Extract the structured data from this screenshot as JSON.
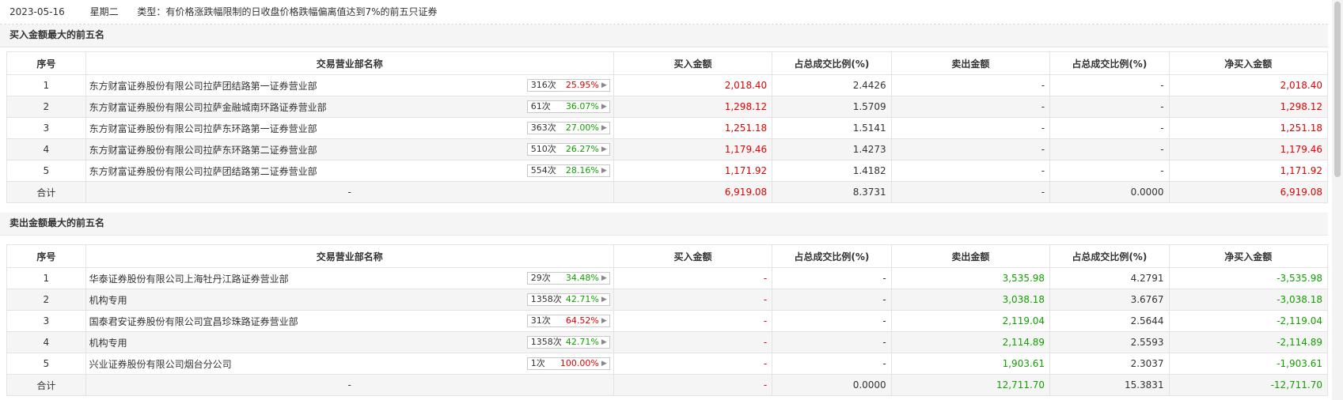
{
  "header": {
    "date": "2023-05-16",
    "weekday": "星期二",
    "type_label": "类型：",
    "type_text": "有价格涨跌幅限制的日收盘价格跌幅偏离值达到7%的前五只证券"
  },
  "columns": [
    "序号",
    "交易营业部名称",
    "买入金额",
    "占总成交比例(%)",
    "卖出金额",
    "占总成交比例(%)",
    "净买入金额"
  ],
  "icons": {
    "badge_arrow": "chevron-right-icon"
  },
  "colors": {
    "up": "#e40000",
    "down": "#12a000"
  },
  "buy_section": {
    "title": "买入金额最大的前五名",
    "rows": [
      {
        "no": "1",
        "name": "东方财富证券股份有限公司拉萨团结路第一证券营业部",
        "count": "316次",
        "rate": "25.95%",
        "buy": "2,018.40",
        "buy_ratio": "2.4426",
        "sell": "-",
        "sell_ratio": "-",
        "net": "2,018.40"
      },
      {
        "no": "2",
        "name": "东方财富证券股份有限公司拉萨金融城南环路证券营业部",
        "count": "61次",
        "rate": "36.07%",
        "buy": "1,298.12",
        "buy_ratio": "1.5709",
        "sell": "-",
        "sell_ratio": "-",
        "net": "1,298.12"
      },
      {
        "no": "3",
        "name": "东方财富证券股份有限公司拉萨东环路第一证券营业部",
        "count": "363次",
        "rate": "27.00%",
        "buy": "1,251.18",
        "buy_ratio": "1.5141",
        "sell": "-",
        "sell_ratio": "-",
        "net": "1,251.18"
      },
      {
        "no": "4",
        "name": "东方财富证券股份有限公司拉萨东环路第二证券营业部",
        "count": "510次",
        "rate": "26.27%",
        "buy": "1,179.46",
        "buy_ratio": "1.4273",
        "sell": "-",
        "sell_ratio": "-",
        "net": "1,179.46"
      },
      {
        "no": "5",
        "name": "东方财富证券股份有限公司拉萨团结路第二证券营业部",
        "count": "554次",
        "rate": "28.16%",
        "buy": "1,171.92",
        "buy_ratio": "1.4182",
        "sell": "-",
        "sell_ratio": "-",
        "net": "1,171.92"
      }
    ],
    "total": {
      "label": "合计",
      "name": "-",
      "buy": "6,919.08",
      "buy_ratio": "8.3731",
      "sell": "-",
      "sell_ratio": "0.0000",
      "net": "6,919.08"
    }
  },
  "sell_section": {
    "title": "卖出金额最大的前五名",
    "rows": [
      {
        "no": "1",
        "name": "华泰证券股份有限公司上海牡丹江路证券营业部",
        "count": "29次",
        "rate": "34.48%",
        "buy": "-",
        "buy_ratio": "-",
        "sell": "3,535.98",
        "sell_ratio": "4.2791",
        "net": "-3,535.98"
      },
      {
        "no": "2",
        "name": "机构专用",
        "count": "1358次",
        "rate": "42.71%",
        "buy": "-",
        "buy_ratio": "-",
        "sell": "3,038.18",
        "sell_ratio": "3.6767",
        "net": "-3,038.18"
      },
      {
        "no": "3",
        "name": "国泰君安证券股份有限公司宜昌珍珠路证券营业部",
        "count": "31次",
        "rate": "64.52%",
        "buy": "-",
        "buy_ratio": "-",
        "sell": "2,119.04",
        "sell_ratio": "2.5644",
        "net": "-2,119.04"
      },
      {
        "no": "4",
        "name": "机构专用",
        "count": "1358次",
        "rate": "42.71%",
        "buy": "-",
        "buy_ratio": "-",
        "sell": "2,114.89",
        "sell_ratio": "2.5593",
        "net": "-2,114.89"
      },
      {
        "no": "5",
        "name": "兴业证券股份有限公司烟台分公司",
        "count": "1次",
        "rate": "100.00%",
        "buy": "-",
        "buy_ratio": "-",
        "sell": "1,903.61",
        "sell_ratio": "2.3037",
        "net": "-1,903.61"
      }
    ],
    "total": {
      "label": "合计",
      "name": "-",
      "buy": "-",
      "buy_ratio": "0.0000",
      "sell": "12,711.70",
      "sell_ratio": "15.3831",
      "net": "-12,711.70"
    }
  }
}
